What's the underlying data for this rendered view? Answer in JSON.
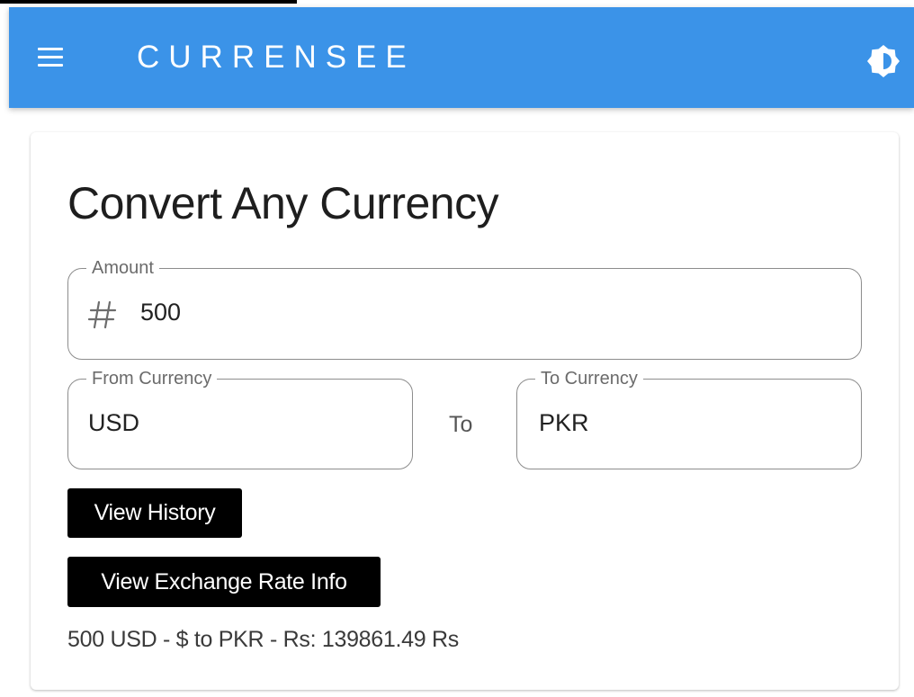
{
  "app": {
    "title": "CURRENSEE",
    "brand_color": "#3b93e8",
    "menu_icon": "hamburger-menu-icon",
    "theme_icon": "brightness-toggle-icon"
  },
  "converter": {
    "heading": "Convert Any Currency",
    "amount": {
      "label": "Amount",
      "value": "500",
      "prefix_icon": "hash-icon"
    },
    "from": {
      "label": "From Currency",
      "value": "USD"
    },
    "separator": "To",
    "to": {
      "label": "To Currency",
      "value": "PKR"
    },
    "buttons": {
      "history": "View History",
      "rate_info": "View Exchange Rate Info"
    },
    "result": "500 USD - $ to PKR - Rs: 139861.49 Rs"
  }
}
